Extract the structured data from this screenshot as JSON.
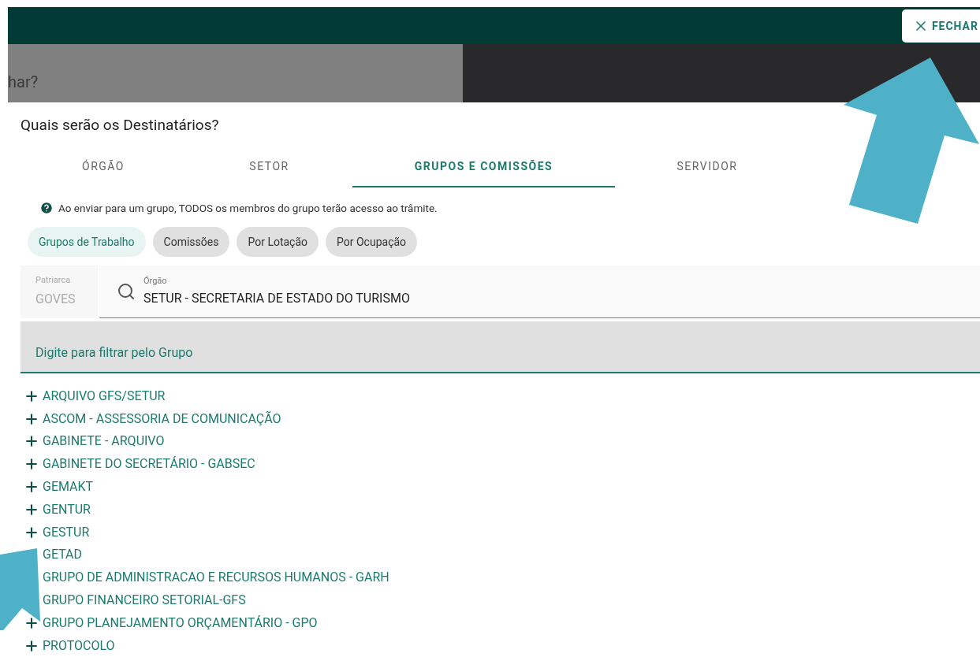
{
  "close_button": {
    "label": "FECHAR"
  },
  "background_title": "har?",
  "dialog": {
    "title": "Quais serão os Destinatários?",
    "tabs": [
      {
        "label": "ÓRGÃO",
        "selected": false
      },
      {
        "label": "SETOR",
        "selected": false
      },
      {
        "label": "GRUPOS E COMISSÕES",
        "selected": true
      },
      {
        "label": "SERVIDOR",
        "selected": false
      }
    ],
    "info": "Ao enviar para um grupo, TODOS os membros do grupo terão acesso ao trâmite.",
    "chips": [
      {
        "label": "Grupos de Trabalho",
        "selected": true
      },
      {
        "label": "Comissões",
        "selected": false
      },
      {
        "label": "Por Lotação",
        "selected": false
      },
      {
        "label": "Por Ocupação",
        "selected": false
      }
    ],
    "patriarca": {
      "label": "Patriarca",
      "value": "GOVES"
    },
    "orgao": {
      "label": "Órgão",
      "value": "SETUR - SECRETARIA DE ESTADO DO TURISMO"
    },
    "filter": {
      "placeholder": "Digite para filtrar pelo Grupo"
    },
    "groups": [
      {
        "label": "ARQUIVO GFS/SETUR",
        "plus_icon": true
      },
      {
        "label": "ASCOM - ASSESSORIA DE COMUNICAÇÃO",
        "plus_icon": true
      },
      {
        "label": "GABINETE - ARQUIVO",
        "plus_icon": true
      },
      {
        "label": "GABINETE DO SECRETÁRIO - GABSEC",
        "plus_icon": true
      },
      {
        "label": "GEMAKT",
        "plus_icon": true
      },
      {
        "label": "GENTUR",
        "plus_icon": true
      },
      {
        "label": "GESTUR",
        "plus_icon": true
      },
      {
        "label": "GETAD",
        "plus_icon": false
      },
      {
        "label": "GRUPO DE ADMINISTRACAO E RECURSOS HUMANOS - GARH",
        "plus_icon": false
      },
      {
        "label": "GRUPO FINANCEIRO SETORIAL-GFS",
        "plus_icon": false
      },
      {
        "label": "GRUPO PLANEJAMENTO ORÇAMENTÁRIO - GPO",
        "plus_icon": true
      },
      {
        "label": "PROTOCOLO",
        "plus_icon": true
      }
    ]
  }
}
